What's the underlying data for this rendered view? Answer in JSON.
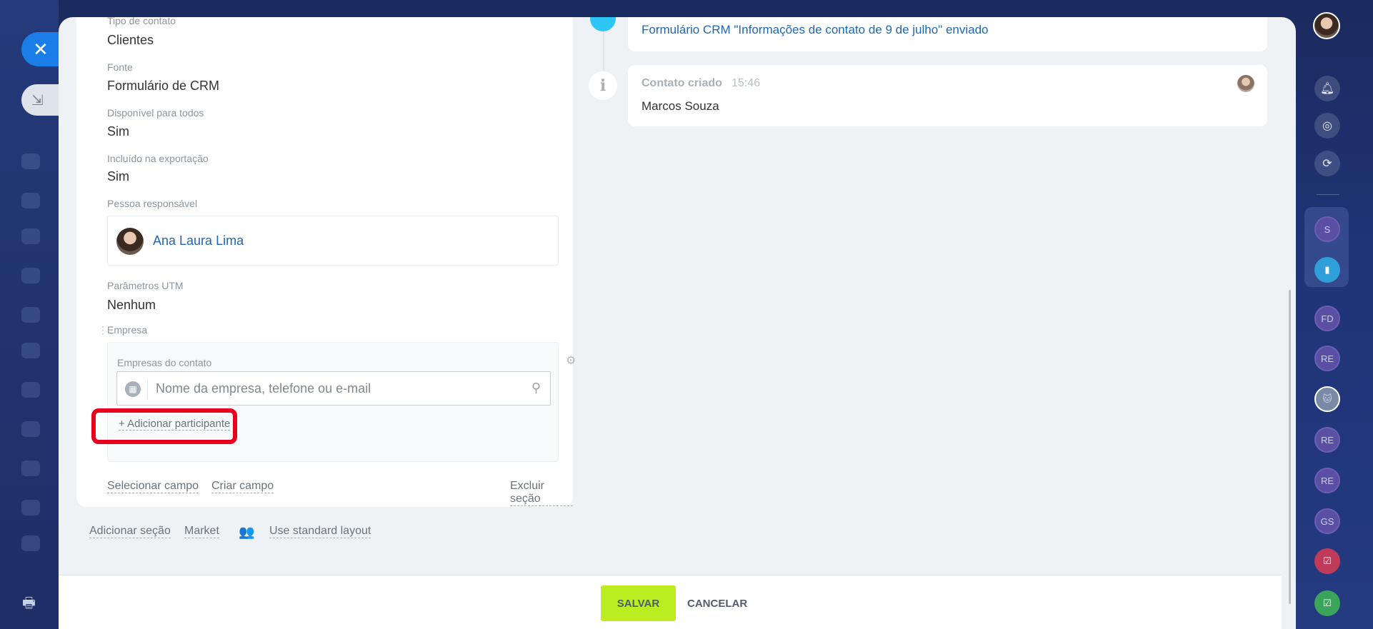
{
  "left_panel": {
    "close_icon": "close-icon",
    "minimize_icon": "minimize-icon",
    "print_icon": "print-icon"
  },
  "fields": {
    "tipo_label": "Tipo de contato",
    "tipo_value": "Clientes",
    "fonte_label": "Fonte",
    "fonte_value": "Formulário de CRM",
    "disponivel_label": "Disponível para todos",
    "disponivel_value": "Sim",
    "exportacao_label": "Incluído na exportação",
    "exportacao_value": "Sim",
    "responsavel_label": "Pessoa responsável",
    "responsavel_name": "Ana Laura Lima",
    "utm_label": "Parâmetros UTM",
    "utm_value": "Nenhum",
    "empresa_label": "Empresa",
    "empresas_contato_label": "Empresas do contato",
    "empresa_search_placeholder": "Nome da empresa, telefone ou e-mail",
    "add_participant": "+ Adicionar participante"
  },
  "section_actions": {
    "select_field": "Selecionar campo",
    "create_field": "Criar campo",
    "delete_section": "Excluir seção"
  },
  "bottom_links": {
    "add_section": "Adicionar seção",
    "market": "Market",
    "standard_layout": "Use standard layout"
  },
  "timeline": {
    "form_sent": "Formulário CRM \"Informações de contato de 9 de julho\" enviado",
    "contact_created_title": "Contato criado",
    "contact_created_time": "15:46",
    "contact_created_name": "Marcos Souza"
  },
  "footer": {
    "save": "SALVAR",
    "cancel": "CANCELAR"
  },
  "right_bar": {
    "items": [
      {
        "icon": "bell-icon"
      },
      {
        "icon": "target-icon"
      },
      {
        "icon": "sync-icon"
      },
      {
        "label": "S"
      },
      {
        "icon": "bookmark-icon"
      },
      {
        "label": "FD"
      },
      {
        "label": "RE"
      },
      {
        "icon": "avatar-image"
      },
      {
        "label": "RE"
      },
      {
        "label": "RE"
      },
      {
        "label": "GS"
      },
      {
        "icon": "task-icon"
      },
      {
        "icon": "task-check-icon"
      }
    ]
  },
  "colors": {
    "accent_blue": "#2067b0",
    "save_green": "#bbed21",
    "highlight_red": "#e8001c",
    "timeline_cyan": "#2fc6f6"
  }
}
